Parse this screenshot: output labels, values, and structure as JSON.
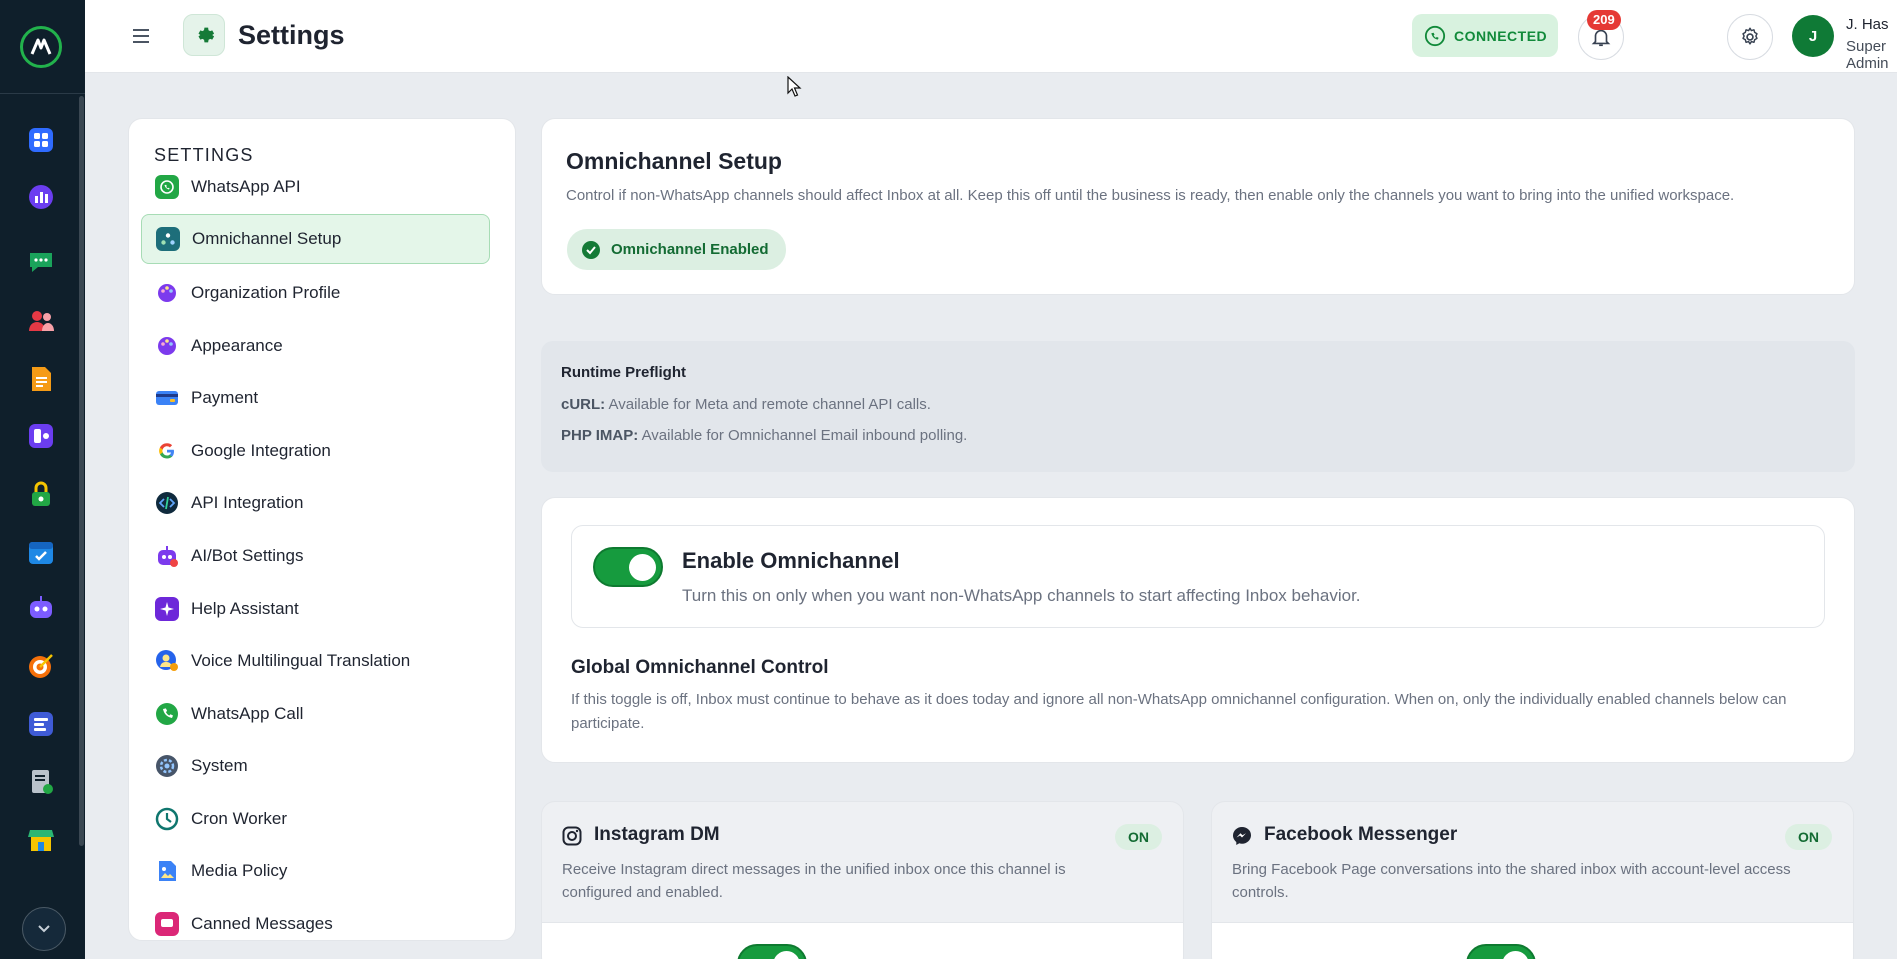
{
  "app": {
    "page_title": "Settings",
    "status_label": "CONNECTED",
    "notification_count": "209",
    "user": {
      "initial": "J",
      "name": "J. Has",
      "role": "Super Admin"
    },
    "colors": {
      "brand": "#169b3e",
      "rail_bg": "#0f1f2b",
      "badge": "#e53935"
    }
  },
  "rail": {
    "items": [
      {
        "icon": "dashboard-icon",
        "color": "#2f6bff"
      },
      {
        "icon": "analytics-icon",
        "color": "#6b3df0"
      },
      {
        "icon": "chat-icon",
        "color": "#1aa35b"
      },
      {
        "icon": "contacts-icon",
        "color": "#e53945"
      },
      {
        "icon": "document-icon",
        "color": "#f59b16"
      },
      {
        "icon": "flow-icon",
        "color": "#6b3df0"
      },
      {
        "icon": "lock-icon",
        "color": "#22a745"
      },
      {
        "icon": "calendar-icon",
        "color": "#1e88e5"
      },
      {
        "icon": "bot-icon",
        "color": "#7c5cff"
      },
      {
        "icon": "target-icon",
        "color": "#f5700a"
      },
      {
        "icon": "board-icon",
        "color": "#3f5bd6"
      },
      {
        "icon": "report-icon",
        "color": "#b9c2cb"
      },
      {
        "icon": "store-icon",
        "color": "#2bb673"
      }
    ]
  },
  "settings_menu": {
    "heading": "SETTINGS",
    "items": [
      {
        "label": "WhatsApp API",
        "icon": "whatsapp-icon",
        "active": false
      },
      {
        "label": "Omnichannel Setup",
        "icon": "omnichannel-icon",
        "active": true
      },
      {
        "label": "Organization Profile",
        "icon": "palette-icon",
        "active": false
      },
      {
        "label": "Appearance",
        "icon": "palette-icon",
        "active": false
      },
      {
        "label": "Payment",
        "icon": "credit-card-icon",
        "active": false
      },
      {
        "label": "Google Integration",
        "icon": "google-icon",
        "active": false
      },
      {
        "label": "API Integration",
        "icon": "code-icon",
        "active": false
      },
      {
        "label": "AI/Bot Settings",
        "icon": "bot-icon",
        "active": false
      },
      {
        "label": "Help Assistant",
        "icon": "sparkle-icon",
        "active": false
      },
      {
        "label": "Voice Multilingual Translation",
        "icon": "voice-icon",
        "active": false
      },
      {
        "label": "WhatsApp Call",
        "icon": "phone-icon",
        "active": false
      },
      {
        "label": "System",
        "icon": "system-gear-icon",
        "active": false
      },
      {
        "label": "Cron Worker",
        "icon": "clock-icon",
        "active": false
      },
      {
        "label": "Media Policy",
        "icon": "image-icon",
        "active": false
      },
      {
        "label": "Canned Messages",
        "icon": "message-icon",
        "active": false
      }
    ]
  },
  "omnichannel": {
    "title": "Omnichannel Setup",
    "description": "Control if non-WhatsApp channels should affect Inbox at all. Keep this off until the business is ready, then enable only the channels you want to bring into the unified workspace.",
    "status_pill": "Omnichannel Enabled"
  },
  "preflight": {
    "title": "Runtime Preflight",
    "curl_key": "cURL:",
    "curl_value": "Available for Meta and remote channel API calls.",
    "imap_key": "PHP IMAP:",
    "imap_value": "Available for Omnichannel Email inbound polling."
  },
  "global_control": {
    "toggle_title": "Enable Omnichannel",
    "toggle_desc": "Turn this on only when you want non-WhatsApp channels to start affecting Inbox behavior.",
    "toggle_on": true,
    "heading": "Global Omnichannel Control",
    "body": "If this toggle is off, Inbox must continue to behave as it does today and ignore all non-WhatsApp omnichannel configuration. When on, only the individually enabled channels below can participate."
  },
  "channels": [
    {
      "title": "Instagram DM",
      "icon": "instagram-icon",
      "badge": "ON",
      "desc": "Receive Instagram direct messages in the unified inbox once this channel is configured and enabled.",
      "enabled": true
    },
    {
      "title": "Facebook Messenger",
      "icon": "messenger-icon",
      "badge": "ON",
      "desc": "Bring Facebook Page conversations into the shared inbox with account-level access controls.",
      "enabled": true
    }
  ]
}
